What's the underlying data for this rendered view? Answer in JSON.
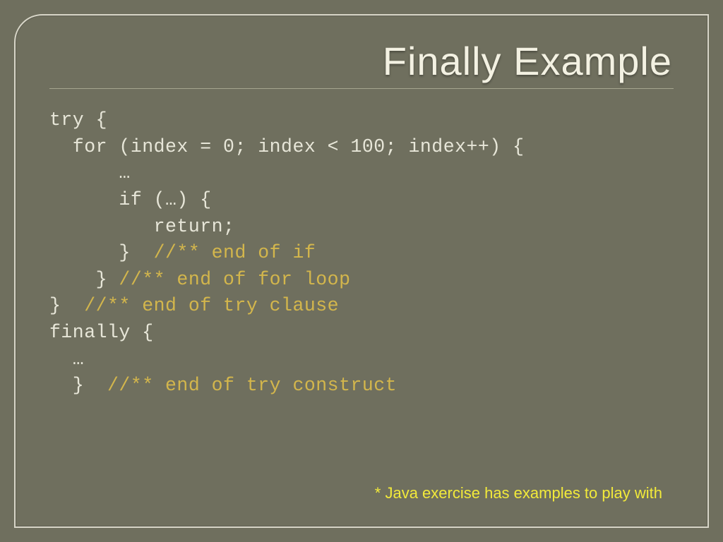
{
  "slide": {
    "title": "Finally Example",
    "code": {
      "l01": "try {",
      "l02": "  for (index = 0; index < 100; index++) {",
      "l03": "      …",
      "l04": "      if (…) {",
      "l05": "         return;",
      "l06a": "      }  ",
      "l06b": "//** end of if",
      "l07a": "    } ",
      "l07b": "//** end of for loop",
      "l08a": "}  ",
      "l08b": "//** end of try clause",
      "l09": "finally {",
      "l10": "  …",
      "l11a": "  }  ",
      "l11b": "//** end of try construct"
    },
    "footnote": "* Java exercise has examples to play with"
  }
}
